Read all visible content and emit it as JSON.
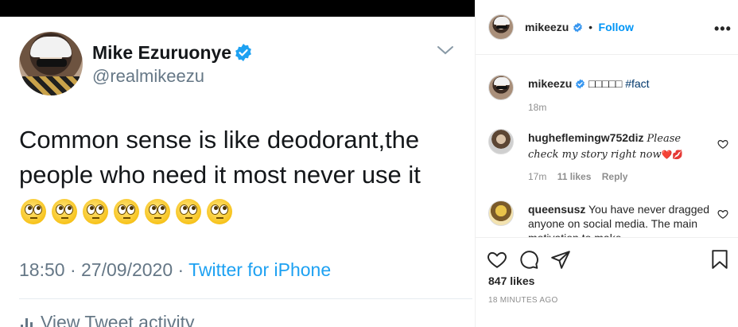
{
  "tweet": {
    "name": "Mike Ezuruonye",
    "handle": "@realmikeezu",
    "text": "Common sense is like deodorant,the people who need it most never use it",
    "emoji_count": 7,
    "time": "18:50",
    "date": "27/09/2020",
    "source": "Twitter for iPhone",
    "activity_label": "View Tweet activity",
    "colors": {
      "text": "#14171a",
      "muted": "#657786",
      "link": "#1da1f2"
    }
  },
  "post": {
    "username": "mikeezu",
    "follow_label": "Follow",
    "caption_username": "mikeezu",
    "caption_glyphs": "□□□□□",
    "caption_hashtag": "#fact",
    "caption_time": "18m",
    "likes": "847 likes",
    "time_ago": "18 MINUTES AGO"
  },
  "comments": [
    {
      "username": "hugheflemingw752diz",
      "text": "Please check my story right now",
      "emoji": "❤️💋",
      "time": "17m",
      "likes": "11 likes",
      "reply_label": "Reply"
    },
    {
      "username": "queensusz",
      "text": "You have never dragged anyone on social media. The main motivation to make"
    }
  ],
  "icons": [
    "verified-badge-icon",
    "chevron-down-icon",
    "more-options-icon",
    "heart-icon",
    "comment-icon",
    "share-icon",
    "bookmark-icon",
    "bar-chart-icon"
  ],
  "colors": {
    "ig_blue": "#0095f6",
    "ig_text": "#262626",
    "ig_muted": "#8e8e8e",
    "tag": "#00376b"
  }
}
